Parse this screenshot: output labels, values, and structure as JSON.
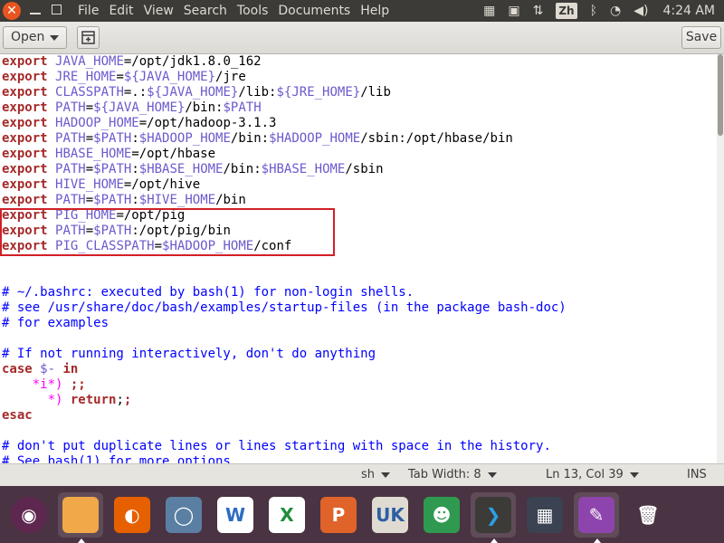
{
  "topbar": {
    "close_glyph": "✕",
    "menus": [
      "File",
      "Edit",
      "View",
      "Search",
      "Tools",
      "Documents",
      "Help"
    ],
    "indicator_icons": [
      "keyboard-icon",
      "clipboard-icon",
      "network-updown-icon",
      "input-method-icon",
      "bluetooth-icon",
      "wifi-icon",
      "volume-icon"
    ],
    "input_method": "Zh",
    "clock": "4:24 AM"
  },
  "toolbar": {
    "open_label": "Open",
    "save_label": "Save"
  },
  "editor": {
    "lines": [
      [
        [
          "kw",
          "export"
        ],
        [
          "t",
          " "
        ],
        [
          "var",
          "JAVA_HOME"
        ],
        [
          "t",
          "=/opt/jdk1.8.0_162"
        ]
      ],
      [
        [
          "kw",
          "export"
        ],
        [
          "t",
          " "
        ],
        [
          "var",
          "JRE_HOME"
        ],
        [
          "t",
          "="
        ],
        [
          "var",
          "${JAVA_HOME}"
        ],
        [
          "t",
          "/jre"
        ]
      ],
      [
        [
          "kw",
          "export"
        ],
        [
          "t",
          " "
        ],
        [
          "var",
          "CLASSPATH"
        ],
        [
          "t",
          "=.:"
        ],
        [
          "var",
          "${JAVA_HOME}"
        ],
        [
          "t",
          "/lib:"
        ],
        [
          "var",
          "${JRE_HOME}"
        ],
        [
          "t",
          "/lib"
        ]
      ],
      [
        [
          "kw",
          "export"
        ],
        [
          "t",
          " "
        ],
        [
          "var",
          "PATH"
        ],
        [
          "t",
          "="
        ],
        [
          "var",
          "${JAVA_HOME}"
        ],
        [
          "t",
          "/bin:"
        ],
        [
          "var",
          "$PATH"
        ]
      ],
      [
        [
          "kw",
          "export"
        ],
        [
          "t",
          " "
        ],
        [
          "var",
          "HADOOP_HOME"
        ],
        [
          "t",
          "=/opt/hadoop-3.1.3"
        ]
      ],
      [
        [
          "kw",
          "export"
        ],
        [
          "t",
          " "
        ],
        [
          "var",
          "PATH"
        ],
        [
          "t",
          "="
        ],
        [
          "var",
          "$PATH"
        ],
        [
          "t",
          ":"
        ],
        [
          "var",
          "$HADOOP_HOME"
        ],
        [
          "t",
          "/bin:"
        ],
        [
          "var",
          "$HADOOP_HOME"
        ],
        [
          "t",
          "/sbin:/opt/hbase/bin"
        ]
      ],
      [
        [
          "kw",
          "export"
        ],
        [
          "t",
          " "
        ],
        [
          "var",
          "HBASE_HOME"
        ],
        [
          "t",
          "=/opt/hbase"
        ]
      ],
      [
        [
          "kw",
          "export"
        ],
        [
          "t",
          " "
        ],
        [
          "var",
          "PATH"
        ],
        [
          "t",
          "="
        ],
        [
          "var",
          "$PATH"
        ],
        [
          "t",
          ":"
        ],
        [
          "var",
          "$HBASE_HOME"
        ],
        [
          "t",
          "/bin:"
        ],
        [
          "var",
          "$HBASE_HOME"
        ],
        [
          "t",
          "/sbin"
        ]
      ],
      [
        [
          "kw",
          "export"
        ],
        [
          "t",
          " "
        ],
        [
          "var",
          "HIVE_HOME"
        ],
        [
          "t",
          "=/opt/hive"
        ]
      ],
      [
        [
          "kw",
          "export"
        ],
        [
          "t",
          " "
        ],
        [
          "var",
          "PATH"
        ],
        [
          "t",
          "="
        ],
        [
          "var",
          "$PATH"
        ],
        [
          "t",
          ":"
        ],
        [
          "var",
          "$HIVE_HOME"
        ],
        [
          "t",
          "/bin"
        ]
      ],
      [
        [
          "kw",
          "export"
        ],
        [
          "t",
          " "
        ],
        [
          "var",
          "PIG_HOME"
        ],
        [
          "t",
          "=/opt/pig"
        ]
      ],
      [
        [
          "kw",
          "export"
        ],
        [
          "t",
          " "
        ],
        [
          "var",
          "PATH"
        ],
        [
          "t",
          "="
        ],
        [
          "var",
          "$PATH"
        ],
        [
          "t",
          ":/opt/pig/bin"
        ]
      ],
      [
        [
          "kw",
          "export"
        ],
        [
          "t",
          " "
        ],
        [
          "var",
          "PIG_CLASSPATH"
        ],
        [
          "t",
          "="
        ],
        [
          "var",
          "$HADOOP_HOME"
        ],
        [
          "t",
          "/conf"
        ]
      ],
      [],
      [],
      [
        [
          "cm",
          "# ~/.bashrc: executed by bash(1) for non-login shells."
        ]
      ],
      [
        [
          "cm",
          "# see /usr/share/doc/bash/examples/startup-files (in the package bash-doc)"
        ]
      ],
      [
        [
          "cm",
          "# for examples"
        ]
      ],
      [],
      [
        [
          "cm",
          "# If not running interactively, don't do anything"
        ]
      ],
      [
        [
          "kw",
          "case"
        ],
        [
          "t",
          " "
        ],
        [
          "var",
          "$-"
        ],
        [
          "t",
          " "
        ],
        [
          "kw",
          "in"
        ]
      ],
      [
        [
          "t",
          "    "
        ],
        [
          "str",
          "*i*)"
        ],
        [
          "t",
          " "
        ],
        [
          "kw",
          ";;"
        ]
      ],
      [
        [
          "t",
          "      "
        ],
        [
          "str",
          "*)"
        ],
        [
          "t",
          " "
        ],
        [
          "kw",
          "return"
        ],
        [
          "t",
          ";"
        ],
        [
          "kw",
          ";"
        ]
      ],
      [
        [
          "kw",
          "esac"
        ]
      ],
      [],
      [
        [
          "cm",
          "# don't put duplicate lines or lines starting with space in the history."
        ]
      ],
      [
        [
          "cm",
          "# See bash(1) for more options"
        ]
      ]
    ]
  },
  "statusbar": {
    "language": "sh",
    "tab_width": "Tab Width: 8",
    "position": "Ln 13, Col 39",
    "mode": "INS"
  },
  "launcher": {
    "apps": [
      {
        "name": "ubuntu-dash-icon",
        "color": "#5e2750",
        "glyph": "◉"
      },
      {
        "name": "files-app-icon",
        "color": "#f0a848",
        "glyph": "",
        "active": true
      },
      {
        "name": "firefox-icon",
        "color": "#e66000",
        "glyph": "◐"
      },
      {
        "name": "screenshot-app-icon",
        "color": "#5b7fa3",
        "glyph": "◯"
      },
      {
        "name": "wps-writer-icon",
        "color": "#ffffff",
        "glyph": "W",
        "fg": "#2b6cc4"
      },
      {
        "name": "wps-spreadsheet-icon",
        "color": "#ffffff",
        "glyph": "X",
        "fg": "#1f8f3a"
      },
      {
        "name": "wps-presentation-icon",
        "color": "#e0632a",
        "glyph": "P"
      },
      {
        "name": "software-center-icon",
        "color": "#dfdbd2",
        "glyph": "UK",
        "fg": "#2d5fa3"
      },
      {
        "name": "robot-app-icon",
        "color": "#2f9a4f",
        "glyph": "☻"
      },
      {
        "name": "vscode-icon",
        "color": "#3c3b37",
        "glyph": "❯",
        "active": true,
        "fg": "#2aa1e8"
      },
      {
        "name": "workspace-switcher-icon",
        "color": "#3b4252",
        "glyph": "▦"
      },
      {
        "name": "text-editor-icon",
        "color": "#8e44ad",
        "glyph": "✎",
        "active": true
      },
      {
        "name": "trash-icon",
        "color": "#4a3342",
        "glyph": "🗑"
      }
    ]
  }
}
